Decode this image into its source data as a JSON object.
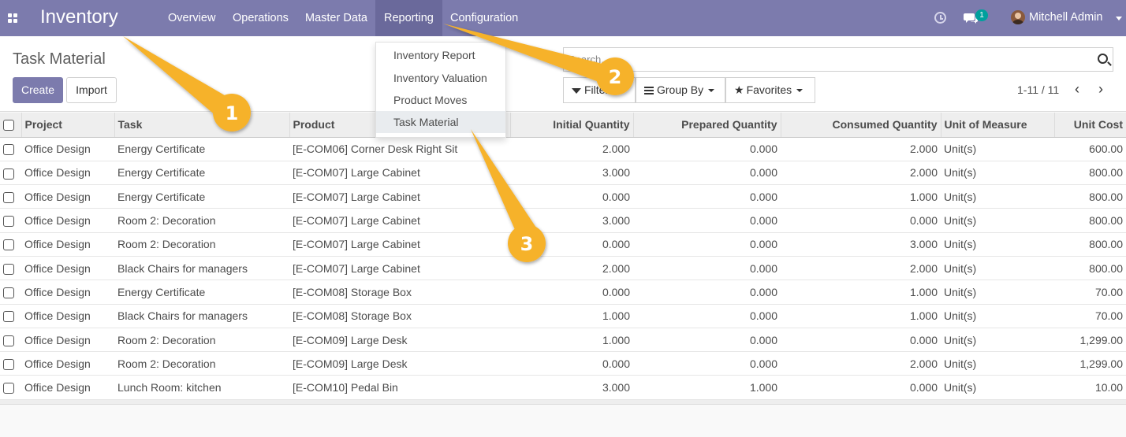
{
  "navbar": {
    "app_title": "Inventory",
    "menu": [
      "Overview",
      "Operations",
      "Master Data",
      "Reporting",
      "Configuration"
    ],
    "active_menu": "Reporting",
    "chat_badge": "1",
    "user_name": "Mitchell Admin",
    "accent_color": "#7c7bad"
  },
  "page": {
    "breadcrumb": "Task Material",
    "create_label": "Create",
    "import_label": "Import",
    "search_placeholder": "Search...",
    "filters_label": "Filters",
    "groupby_label": "Group By",
    "favorites_label": "Favorites",
    "pager": "1-11 / 11"
  },
  "reporting_menu": {
    "items": [
      "Inventory Report",
      "Inventory Valuation",
      "Product Moves",
      "Task Material"
    ],
    "active_item": "Task Material"
  },
  "annotations": [
    "1",
    "2",
    "3"
  ],
  "table": {
    "columns": [
      "Project",
      "Task",
      "Product",
      "Initial Quantity",
      "Prepared Quantity",
      "Consumed Quantity",
      "Unit of Measure",
      "Unit Cost"
    ],
    "rows": [
      [
        "Office Design",
        "Energy Certificate",
        "[E-COM06] Corner Desk Right Sit",
        "2.000",
        "0.000",
        "2.000",
        "Unit(s)",
        "600.00"
      ],
      [
        "Office Design",
        "Energy Certificate",
        "[E-COM07] Large Cabinet",
        "3.000",
        "0.000",
        "2.000",
        "Unit(s)",
        "800.00"
      ],
      [
        "Office Design",
        "Energy Certificate",
        "[E-COM07] Large Cabinet",
        "0.000",
        "0.000",
        "1.000",
        "Unit(s)",
        "800.00"
      ],
      [
        "Office Design",
        "Room 2: Decoration",
        "[E-COM07] Large Cabinet",
        "3.000",
        "0.000",
        "0.000",
        "Unit(s)",
        "800.00"
      ],
      [
        "Office Design",
        "Room 2: Decoration",
        "[E-COM07] Large Cabinet",
        "0.000",
        "0.000",
        "3.000",
        "Unit(s)",
        "800.00"
      ],
      [
        "Office Design",
        "Black Chairs for managers",
        "[E-COM07] Large Cabinet",
        "2.000",
        "0.000",
        "2.000",
        "Unit(s)",
        "800.00"
      ],
      [
        "Office Design",
        "Energy Certificate",
        "[E-COM08] Storage Box",
        "0.000",
        "0.000",
        "1.000",
        "Unit(s)",
        "70.00"
      ],
      [
        "Office Design",
        "Black Chairs for managers",
        "[E-COM08] Storage Box",
        "1.000",
        "0.000",
        "1.000",
        "Unit(s)",
        "70.00"
      ],
      [
        "Office Design",
        "Room 2: Decoration",
        "[E-COM09] Large Desk",
        "1.000",
        "0.000",
        "0.000",
        "Unit(s)",
        "1,299.00"
      ],
      [
        "Office Design",
        "Room 2: Decoration",
        "[E-COM09] Large Desk",
        "0.000",
        "0.000",
        "2.000",
        "Unit(s)",
        "1,299.00"
      ],
      [
        "Office Design",
        "Lunch Room: kitchen",
        "[E-COM10] Pedal Bin",
        "3.000",
        "1.000",
        "0.000",
        "Unit(s)",
        "10.00"
      ]
    ]
  }
}
